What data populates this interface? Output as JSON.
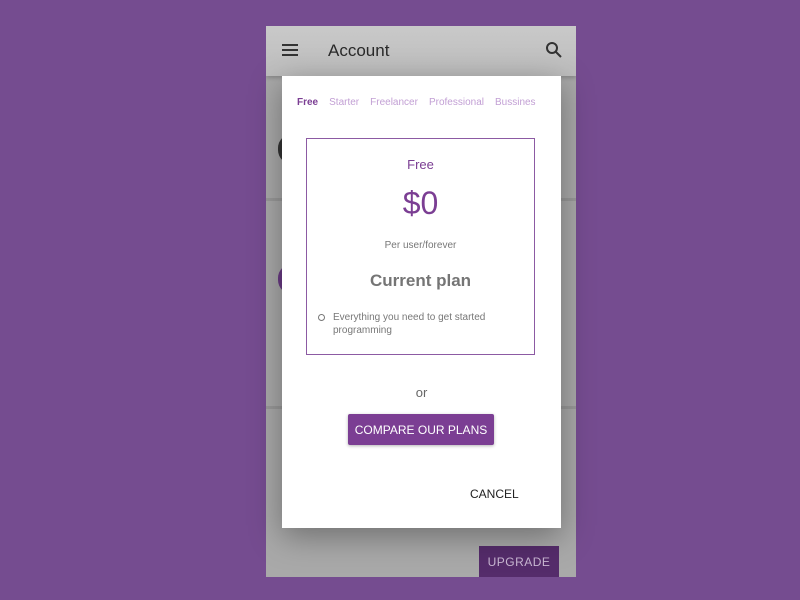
{
  "app": {
    "title": "Account",
    "upgrade_label": "UPGRADE"
  },
  "dialog": {
    "tabs": [
      {
        "label": "Free",
        "active": true
      },
      {
        "label": "Starter",
        "active": false
      },
      {
        "label": "Freelancer",
        "active": false
      },
      {
        "label": "Professional",
        "active": false
      },
      {
        "label": "Bussines",
        "active": false
      }
    ],
    "plan": {
      "name": "Free",
      "price": "$0",
      "period": "Per user/forever",
      "status": "Current plan",
      "features": [
        "Everything you need to get started programming"
      ]
    },
    "or_label": "or",
    "compare_label": "COMPARE OUR PLANS",
    "cancel_label": "CANCEL"
  },
  "colors": {
    "brand": "#7b3e93",
    "background": "#754c90",
    "tab_inactive": "#c29fd4"
  }
}
